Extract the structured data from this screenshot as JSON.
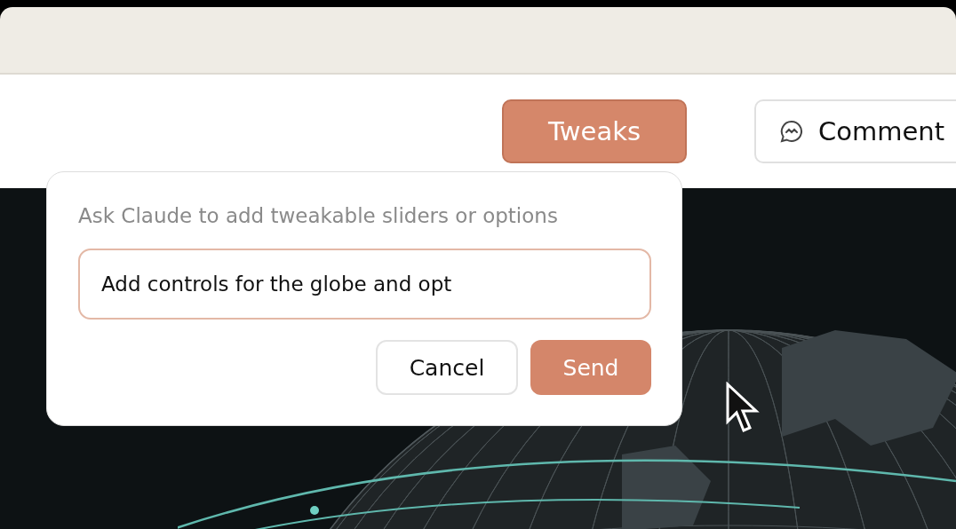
{
  "toolbar": {
    "buttons": [
      {
        "label": "Tweaks",
        "kind": "primary"
      },
      {
        "label": "Comment",
        "kind": "comment"
      }
    ]
  },
  "popup": {
    "prompt": "Ask Claude to add tweakable sliders or options",
    "input": {
      "value": "Add controls for the globe and opt"
    },
    "buttons": [
      {
        "label": "Cancel",
        "kind": "secondary"
      },
      {
        "label": "Send",
        "kind": "primary"
      }
    ]
  }
}
